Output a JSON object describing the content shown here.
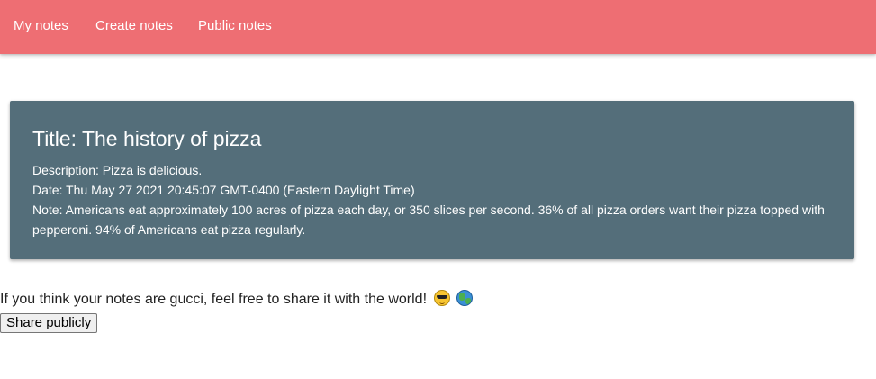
{
  "nav": {
    "items": [
      {
        "label": "My notes"
      },
      {
        "label": "Create notes"
      },
      {
        "label": "Public notes"
      }
    ]
  },
  "note": {
    "title": "Title: The history of pizza",
    "description": "Description: Pizza is delicious.",
    "date": "Date: Thu May 27 2021 20:45:07 GMT-0400 (Eastern Daylight Time)",
    "note": "Note: Americans eat approximately 100 acres of pizza each day, or 350 slices per second. 36% of all pizza orders want their pizza topped with pepperoni. 94% of Americans eat pizza regularly."
  },
  "share": {
    "text": "If you think your notes are gucci, feel free to share it with the world!",
    "emojis": [
      "smiling-face-with-sunglasses",
      "globe"
    ],
    "button_label": "Share publicly"
  },
  "colors": {
    "navbar": "#ee6e73",
    "card": "#546e7a"
  }
}
